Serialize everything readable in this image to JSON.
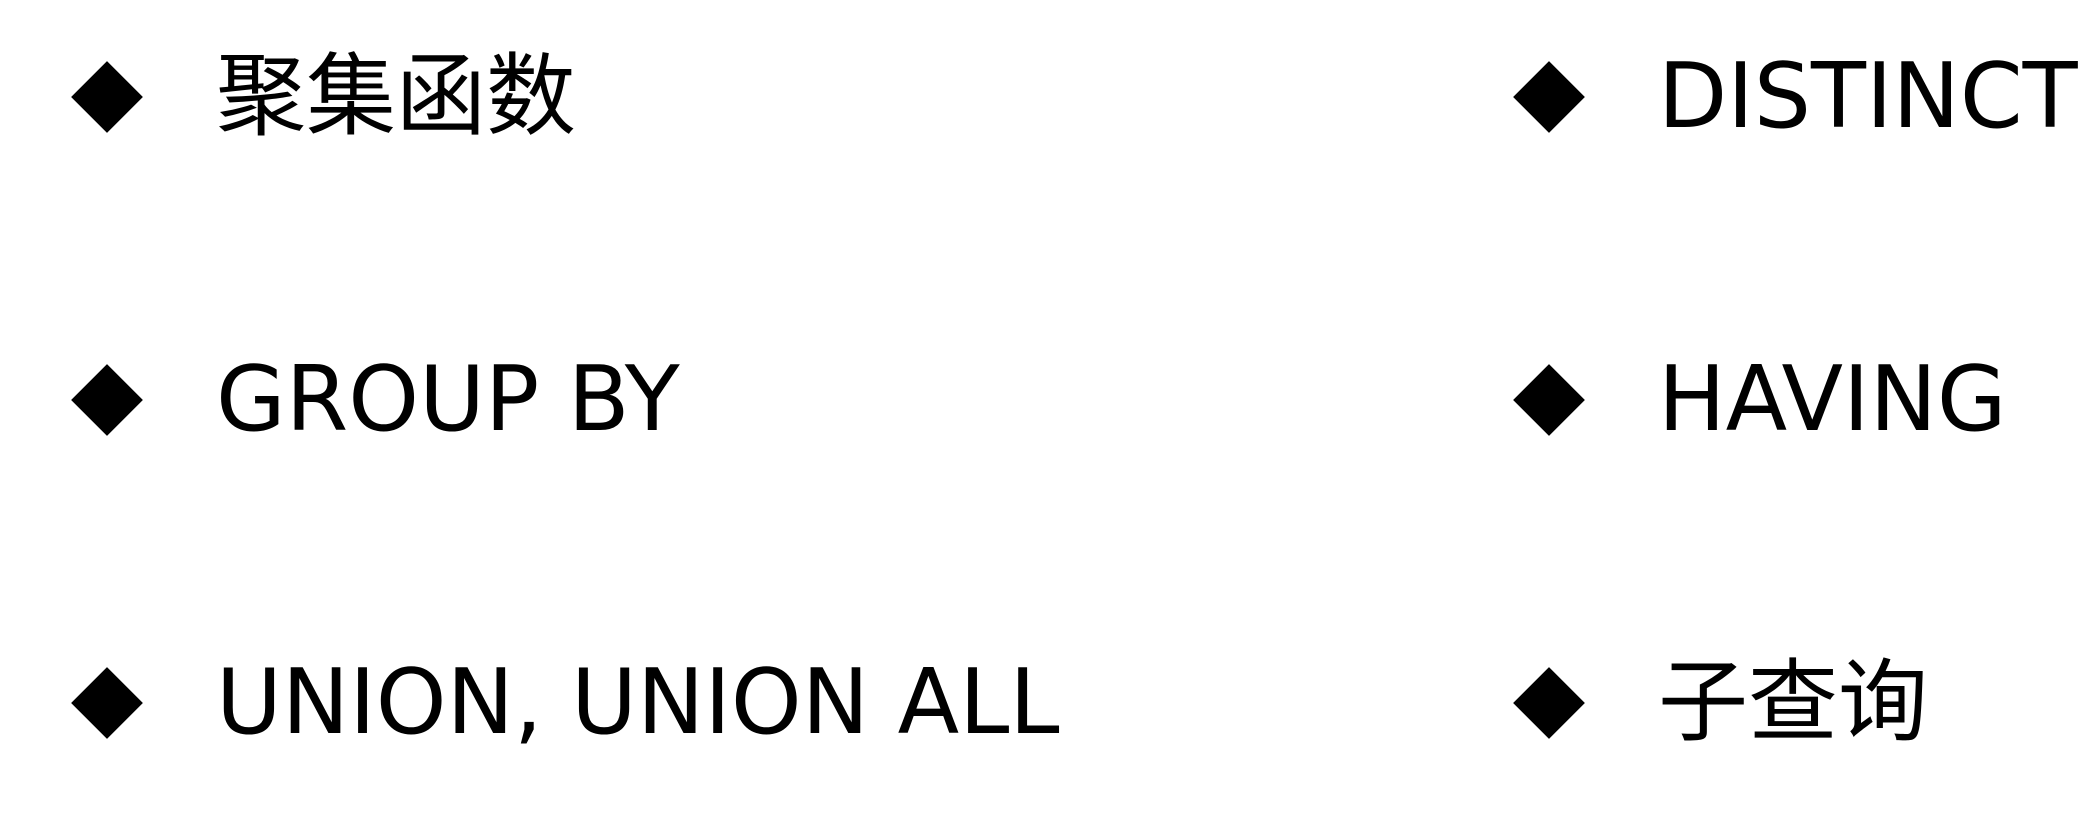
{
  "items": [
    {
      "label": "聚集函数",
      "icon": "diamond-bullet-icon"
    },
    {
      "label": "DISTINCT",
      "icon": "diamond-bullet-icon"
    },
    {
      "label": "GROUP BY",
      "icon": "diamond-bullet-icon"
    },
    {
      "label": "HAVING",
      "icon": "diamond-bullet-icon"
    },
    {
      "label": "UNION, UNION ALL",
      "icon": "diamond-bullet-icon"
    },
    {
      "label": "子查询",
      "icon": "diamond-bullet-icon"
    }
  ],
  "colors": {
    "background": "#ffffff",
    "text": "#000000",
    "bullet": "#000000"
  }
}
